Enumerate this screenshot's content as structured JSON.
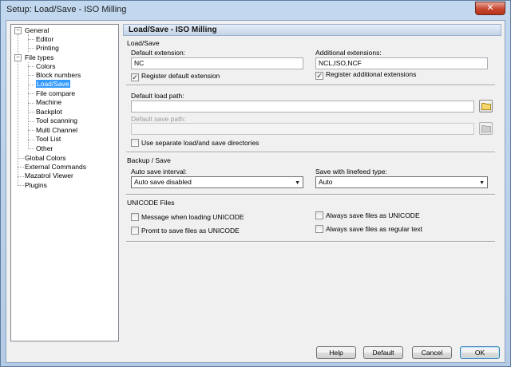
{
  "window": {
    "title": "Setup: Load/Save - ISO Milling",
    "close_glyph": "✕"
  },
  "tree": {
    "items": [
      {
        "label": "General",
        "expander": "−"
      },
      {
        "label": "Editor"
      },
      {
        "label": "Printing"
      },
      {
        "label": "File types",
        "expander": "−"
      },
      {
        "label": "Colors"
      },
      {
        "label": "Block numbers"
      },
      {
        "label": "Load/Save"
      },
      {
        "label": "File compare"
      },
      {
        "label": "Machine"
      },
      {
        "label": "Backplot"
      },
      {
        "label": "Tool scanning"
      },
      {
        "label": "Multi Channel"
      },
      {
        "label": "Tool List"
      },
      {
        "label": "Other"
      },
      {
        "label": "Global Colors"
      },
      {
        "label": "External Commands"
      },
      {
        "label": "Mazatrol Viewer"
      },
      {
        "label": "Plugins"
      }
    ]
  },
  "panel": {
    "header": "Load/Save - ISO Milling",
    "load_save": {
      "group_label": "Load/Save",
      "default_ext_label": "Default extension:",
      "default_ext_value": "NC",
      "register_default_label": "Register default extension",
      "register_default_checked": "✓",
      "additional_ext_label": "Additional extensions:",
      "additional_ext_value": "NCL,ISO,NCF",
      "register_additional_label": "Register additional extensions",
      "register_additional_checked": "✓",
      "default_load_path_label": "Default load path:",
      "default_load_path_value": "",
      "default_save_path_label": "Default save path:",
      "default_save_path_value": "",
      "separate_dirs_label": "Use separate load/and save directories",
      "separate_dirs_checked": ""
    },
    "backup": {
      "group_label": "Backup / Save",
      "auto_save_label": "Auto save interval:",
      "auto_save_value": "Auto save disabled",
      "linefeed_label": "Save with linefeed type:",
      "linefeed_value": "Auto"
    },
    "unicode": {
      "group_label": "UNICODE Files",
      "msg_loading_label": "Message when loading UNICODE",
      "msg_loading_checked": "",
      "prompt_save_label": "Promt to save files as UNICODE",
      "prompt_save_checked": "",
      "always_unicode_label": "Always save files as UNICODE",
      "always_unicode_checked": "",
      "always_regular_label": "Always save files as regular text",
      "always_regular_checked": ""
    }
  },
  "buttons": {
    "help": "Help",
    "default": "Default",
    "cancel": "Cancel",
    "ok": "OK"
  },
  "colors": {
    "selection": "#3399ff",
    "header_bg": "#c3d3e8",
    "close": "#c7472f"
  }
}
